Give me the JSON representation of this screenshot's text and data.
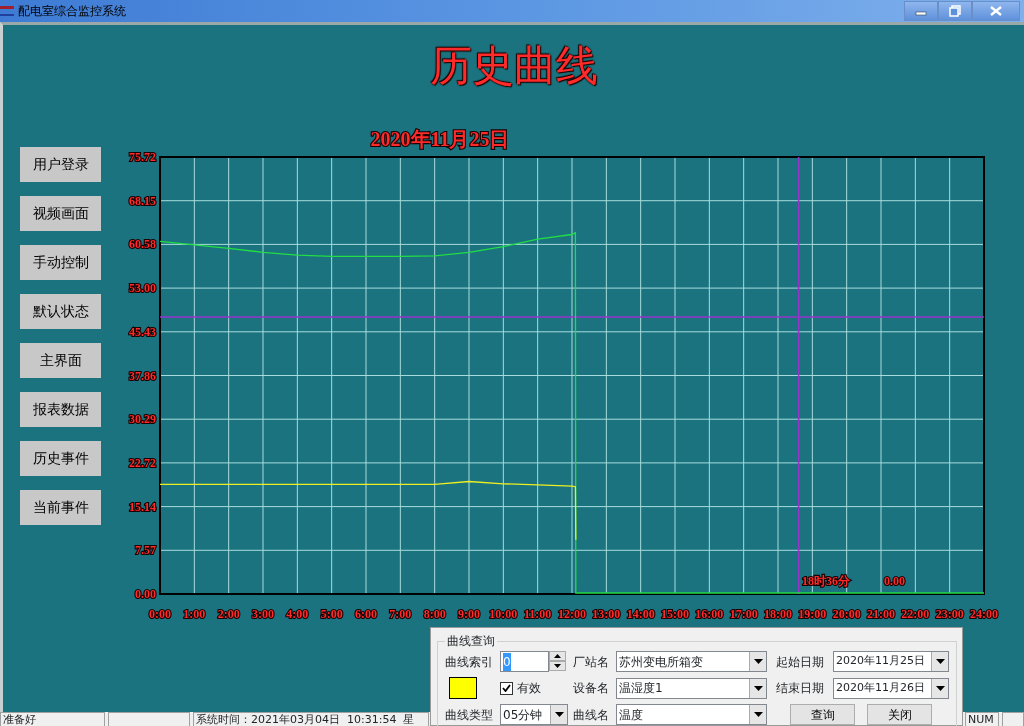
{
  "window": {
    "title": "配电室综合监控系统"
  },
  "header": {
    "title": "历史曲线"
  },
  "sidebar": {
    "items": [
      {
        "label": "用户登录"
      },
      {
        "label": "视频画面"
      },
      {
        "label": "手动控制"
      },
      {
        "label": "默认状态"
      },
      {
        "label": "主界面"
      },
      {
        "label": "报表数据"
      },
      {
        "label": "历史事件"
      },
      {
        "label": "当前事件"
      }
    ]
  },
  "chart": {
    "chart_data": {
      "type": "line",
      "title": "2020年11月25日",
      "x": [
        0,
        1,
        2,
        3,
        4,
        5,
        6,
        7,
        8,
        9,
        10,
        11,
        12,
        12.1,
        12.11,
        13,
        14,
        15,
        16,
        17,
        18,
        19,
        20,
        21,
        22,
        23,
        24
      ],
      "series": [
        {
          "color": "#22dd44",
          "values": [
            61.1,
            60.5,
            59.9,
            59.2,
            58.7,
            58.5,
            58.5,
            58.5,
            58.6,
            59.2,
            60.2,
            61.5,
            62.3,
            62.6,
            0,
            0,
            0,
            0,
            0,
            0,
            0,
            0,
            0,
            0,
            0,
            0,
            0
          ]
        },
        {
          "color": "#eeee22",
          "values": [
            19.0,
            19.0,
            19.0,
            19.0,
            19.0,
            19.0,
            19.0,
            19.0,
            19.0,
            19.5,
            19.1,
            18.9,
            18.7,
            18.6,
            9.4,
            null,
            null,
            null,
            null,
            null,
            null,
            null,
            null,
            null,
            null,
            null,
            null
          ]
        }
      ],
      "xlim": [
        0,
        24
      ],
      "ylim": [
        0,
        75.72
      ],
      "xticks": [
        {
          "value": 0,
          "label": "0:00"
        },
        {
          "value": 1,
          "label": "1:00"
        },
        {
          "value": 2,
          "label": "2:00"
        },
        {
          "value": 3,
          "label": "3:00"
        },
        {
          "value": 4,
          "label": "4:00"
        },
        {
          "value": 5,
          "label": "5:00"
        },
        {
          "value": 6,
          "label": "6:00"
        },
        {
          "value": 7,
          "label": "7:00"
        },
        {
          "value": 8,
          "label": "8:00"
        },
        {
          "value": 9,
          "label": "9:00"
        },
        {
          "value": 10,
          "label": "10:00"
        },
        {
          "value": 11,
          "label": "11:00"
        },
        {
          "value": 12,
          "label": "12:00"
        },
        {
          "value": 13,
          "label": "13:00"
        },
        {
          "value": 14,
          "label": "14:00"
        },
        {
          "value": 15,
          "label": "15:00"
        },
        {
          "value": 16,
          "label": "16:00"
        },
        {
          "value": 17,
          "label": "17:00"
        },
        {
          "value": 18,
          "label": "18:00"
        },
        {
          "value": 19,
          "label": "19:00"
        },
        {
          "value": 20,
          "label": "20:00"
        },
        {
          "value": 21,
          "label": "21:00"
        },
        {
          "value": 22,
          "label": "22:00"
        },
        {
          "value": 23,
          "label": "23:00"
        },
        {
          "value": 24,
          "label": "24:00"
        }
      ],
      "yticks": [
        {
          "value": 0,
          "label": "0.00"
        },
        {
          "value": 7.572,
          "label": "7.57"
        },
        {
          "value": 15.144,
          "label": "15.14"
        },
        {
          "value": 22.716,
          "label": "22.72"
        },
        {
          "value": 30.288,
          "label": "30.29"
        },
        {
          "value": 37.86,
          "label": "37.86"
        },
        {
          "value": 45.432,
          "label": "45.43"
        },
        {
          "value": 53.004,
          "label": "53.00"
        },
        {
          "value": 60.576,
          "label": "60.58"
        },
        {
          "value": 68.148,
          "label": "68.15"
        },
        {
          "value": 75.72,
          "label": "75.72"
        }
      ],
      "grid": true,
      "ref_lines": [
        {
          "axis": "x",
          "value": 18.6,
          "color": "#9933cc"
        },
        {
          "axis": "y",
          "value": 48.0,
          "color": "#9933cc"
        }
      ],
      "annotations": [
        {
          "text": "18时36分",
          "x": 18.7,
          "y": 1.5
        },
        "0.00"
      ]
    }
  },
  "query_dialog": {
    "title": "曲线查询",
    "curve_index": {
      "label": "曲线索引",
      "value": "0"
    },
    "station": {
      "label": "厂站名",
      "value": "苏州变电所箱变"
    },
    "start_date": {
      "label": "起始日期",
      "value": "2020年11月25日"
    },
    "swatch": {
      "color": "#ffff00"
    },
    "valid": {
      "label": "有效",
      "checked": true
    },
    "device": {
      "label": "设备名",
      "value": "温湿度1"
    },
    "end_date": {
      "label": "结束日期",
      "value": "2020年11月26日"
    },
    "curve_type": {
      "label": "曲线类型",
      "value": "05分钟"
    },
    "curve_name": {
      "label": "曲线名",
      "value": "温度"
    },
    "buttons": [
      "查询",
      "关闭"
    ]
  },
  "status_bar": {
    "panes": [
      {
        "text": "准备好"
      },
      {
        "text": "系统时间：2021年03月04日  10:31:54  星"
      },
      {
        "text": "NUM"
      }
    ]
  }
}
